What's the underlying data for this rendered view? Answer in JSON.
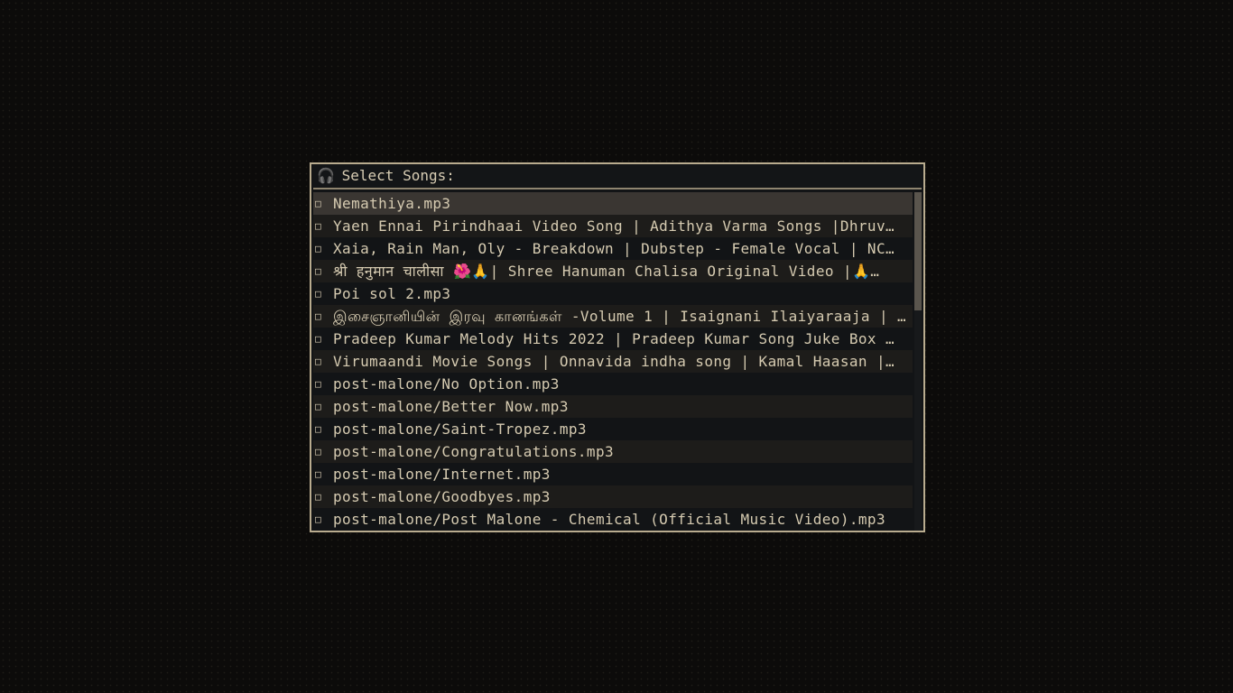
{
  "header": {
    "icon": "headphones-icon",
    "title": "Select Songs:"
  },
  "checkbox_glyph": "□",
  "songs": [
    {
      "label": "Nemathiya.mp3",
      "selected": true
    },
    {
      "label": "Yaen Ennai Pirindhaai Video Song | Adithya Varma Songs |Dhruv…"
    },
    {
      "label": "Xaia, Rain Man, Oly - Breakdown | Dubstep - Female Vocal | NC…"
    },
    {
      "label": "श्री हनुमान चालीसा 🌺🙏| Shree Hanuman Chalisa Original Video |🙏…"
    },
    {
      "label": "Poi sol 2.mp3"
    },
    {
      "label": "இசைஞானியின் இரவு கானங்கள் -Volume 1 | Isaignani Ilaiyaraaja | Tami…"
    },
    {
      "label": "Pradeep Kumar Melody Hits 2022 | Pradeep Kumar Song Juke Box …"
    },
    {
      "label": "Virumaandi Movie Songs | Onnavida indha song | Kamal Haasan |…"
    },
    {
      "label": "post-malone/No Option.mp3"
    },
    {
      "label": "post-malone/Better Now.mp3"
    },
    {
      "label": "post-malone/Saint-Tropez.mp3"
    },
    {
      "label": "post-malone/Congratulations.mp3"
    },
    {
      "label": "post-malone/Internet.mp3"
    },
    {
      "label": "post-malone/Goodbyes.mp3"
    },
    {
      "label": "post-malone/Post Malone - Chemical (Official Music Video).mp3"
    }
  ],
  "scroll": {
    "position_fraction": 0.0,
    "visible_fraction": 0.35
  }
}
